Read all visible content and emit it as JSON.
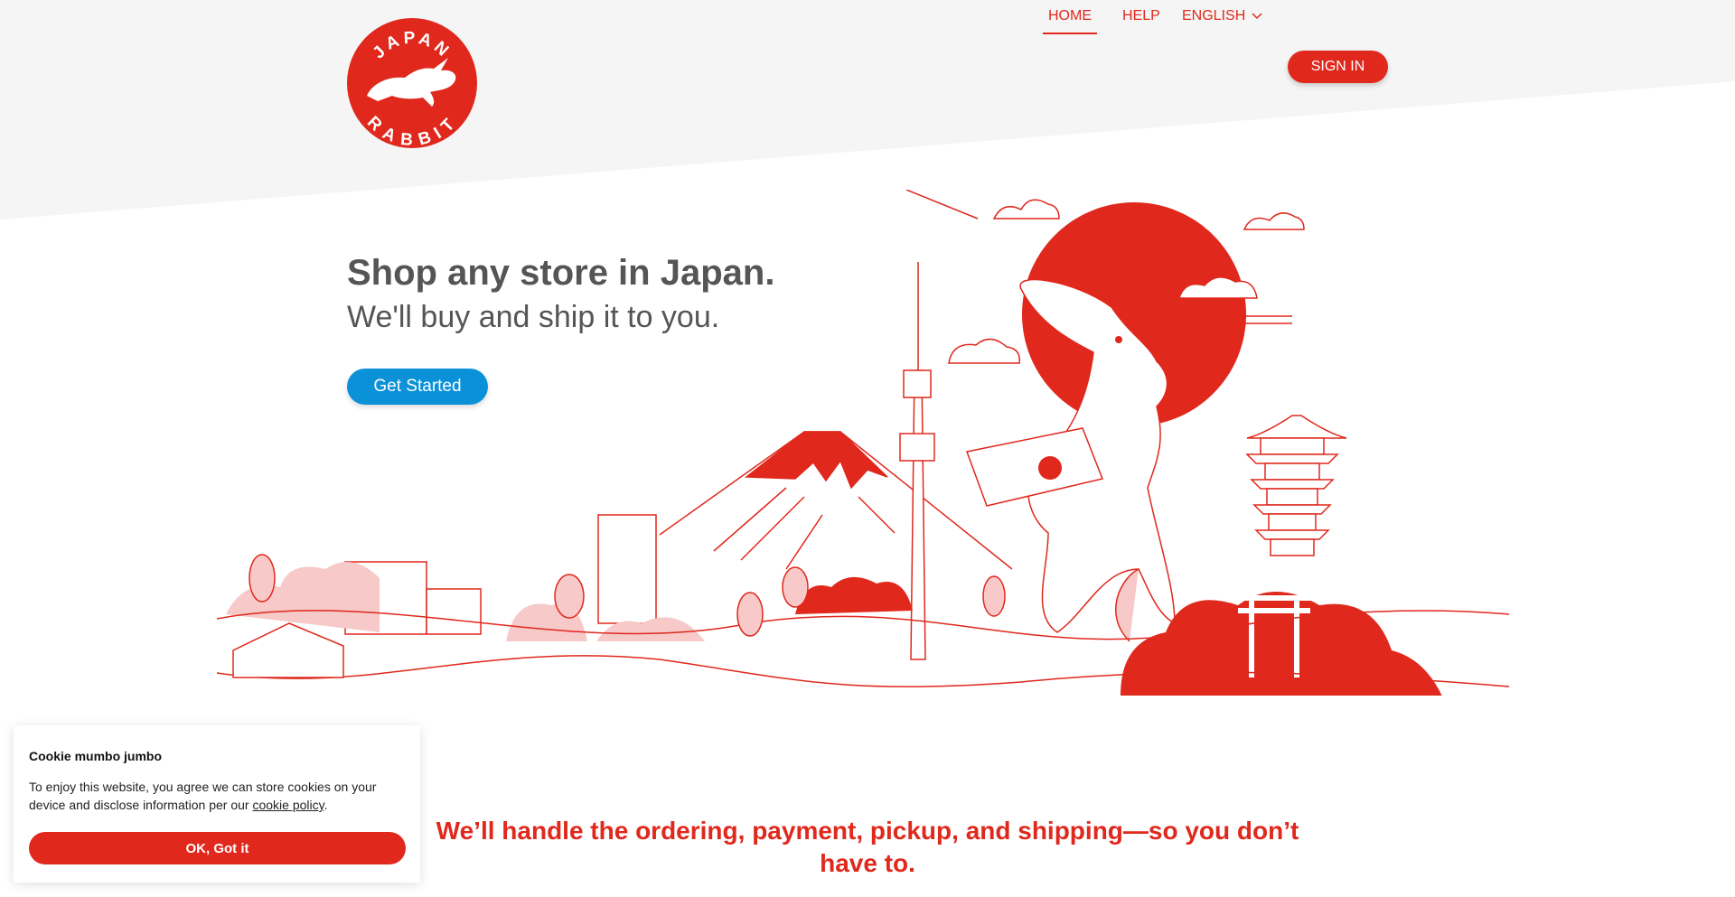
{
  "logo": {
    "top_text": "JAPAN",
    "bottom_text": "RABBIT"
  },
  "nav": {
    "home": "HOME",
    "help": "HELP",
    "language": "ENGLISH",
    "sign_in": "SIGN IN"
  },
  "hero": {
    "title": "Shop any store in Japan.",
    "subtitle": "We'll buy and ship it to you.",
    "cta": "Get Started"
  },
  "tagline": "We’ll handle the ordering, payment, pickup, and shipping—so you don’t have to.",
  "cookie": {
    "title": "Cookie mumbo jumbo",
    "text_before": "To enjoy this website, you agree we can store cookies on your device and disclose information per our ",
    "link": "cookie policy",
    "text_after": ".",
    "button": "OK, Got it"
  },
  "colors": {
    "brand_red": "#e0281c",
    "cta_blue": "#0a91d8",
    "pink": "#f7c9c9",
    "band_gray": "#f5f5f5"
  },
  "icons": [
    "rabbit-logo-icon",
    "chevron-down-icon"
  ]
}
